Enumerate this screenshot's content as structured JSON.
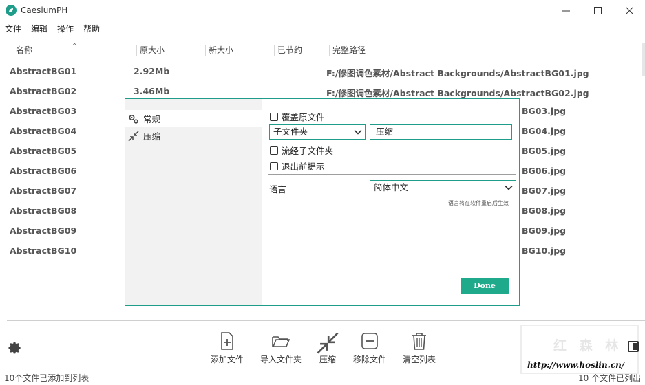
{
  "window": {
    "title": "CaesiumPH",
    "icon": "caesium-leaf-icon",
    "controls": [
      "minimize-icon",
      "maximize-icon",
      "close-icon"
    ]
  },
  "menu": [
    "文件",
    "编辑",
    "操作",
    "帮助"
  ],
  "table": {
    "columns": [
      "名称",
      "原大小",
      "新大小",
      "已节约",
      "完整路径"
    ],
    "rows": [
      {
        "name": "AbstractBG01",
        "original_size": "2.92Mb",
        "path": "F:/修图调色素材/Abstract Backgrounds/AbstractBG01.jpg"
      },
      {
        "name": "AbstractBG02",
        "original_size": "3.46Mb",
        "path": "F:/修图调色素材/Abstract Backgrounds/AbstractBG02.jpg"
      },
      {
        "name": "AbstractBG03",
        "original_size": "",
        "path": "BG03.jpg"
      },
      {
        "name": "AbstractBG04",
        "original_size": "",
        "path": "BG04.jpg"
      },
      {
        "name": "AbstractBG05",
        "original_size": "",
        "path": "BG05.jpg"
      },
      {
        "name": "AbstractBG06",
        "original_size": "",
        "path": "BG06.jpg"
      },
      {
        "name": "AbstractBG07",
        "original_size": "",
        "path": "BG07.jpg"
      },
      {
        "name": "AbstractBG08",
        "original_size": "",
        "path": "BG08.jpg"
      },
      {
        "name": "AbstractBG09",
        "original_size": "",
        "path": "BG09.jpg"
      },
      {
        "name": "AbstractBG10",
        "original_size": "",
        "path": "BG10.jpg"
      }
    ]
  },
  "toolbar": {
    "add_file": "添加文件",
    "import_folder": "导入文件夹",
    "compress": "压缩",
    "remove_file": "移除文件",
    "clear_list": "清空列表"
  },
  "status": {
    "left": "10个文件已添加到列表",
    "right": "10 个文件已列出"
  },
  "watermark": {
    "top": "红 森 林",
    "url": "http://www.hoslin.cn/"
  },
  "dialog": {
    "nav": [
      "常规",
      "压缩"
    ],
    "overwrite_label": "覆盖原文件",
    "output_mode": "子文件夹",
    "subfolder_name": "压缩",
    "scan_subfolders_label": "流经子文件夹",
    "prompt_on_exit_label": "退出前提示",
    "language_label": "语言",
    "language_value": "简体中文",
    "language_hint": "语言将在软件重启后生效",
    "done": "Done"
  },
  "colors": {
    "accent": "#1f9c8a",
    "done_button": "#1faa8c"
  }
}
